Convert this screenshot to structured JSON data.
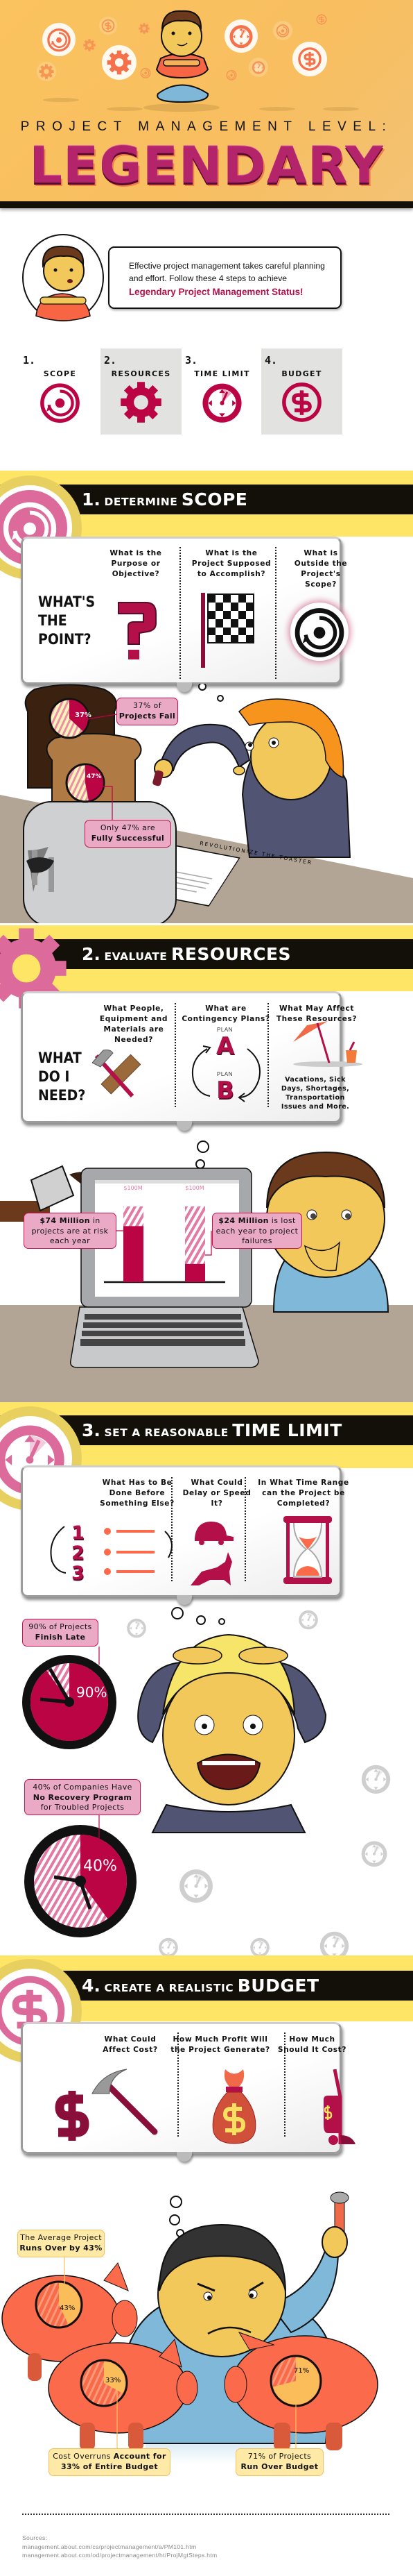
{
  "header": {
    "supertitle": "PROJECT MANAGEMENT LEVEL:",
    "title": "LEGENDARY"
  },
  "intro": {
    "text": "Effective project management takes careful planning and effort. Follow these 4 steps to achieve",
    "highlight": "Legendary Project Management Status!"
  },
  "steps": [
    {
      "number": "1.",
      "label": "SCOPE",
      "icon": "scope-target-icon"
    },
    {
      "number": "2.",
      "label": "RESOURCES",
      "icon": "gear-icon"
    },
    {
      "number": "3.",
      "label": "TIME LIMIT",
      "icon": "stopwatch-icon"
    },
    {
      "number": "4.",
      "label": "BUDGET",
      "icon": "dollar-coin-icon"
    }
  ],
  "sections": [
    {
      "number": "1.",
      "title_small": "DETERMINE",
      "title_big": "SCOPE",
      "prompt": "WHAT'S THE POINT?",
      "questions": [
        "What is the Purpose or Objective?",
        "What is the Project Supposed to Accomplish?",
        "What is Outside the Project's Scope?"
      ]
    },
    {
      "number": "2.",
      "title_small": "EVALUATE",
      "title_big": "RESOURCES",
      "prompt": "WHAT DO I NEED?",
      "questions": [
        "What People, Equipment and Materials are Needed?",
        "What are Contingency Plans?",
        "What May Affect These Resources?"
      ],
      "plans": [
        {
          "label": "PLAN",
          "letter": "A"
        },
        {
          "label": "PLAN",
          "letter": "B"
        }
      ],
      "affect_caption": "Vacations, Sick Days, Shortages, Transportation Issues and More."
    },
    {
      "number": "3.",
      "title_small": "SET A REASONABLE",
      "title_big": "TIME LIMIT",
      "questions": [
        "What Has to Be Done Before Something Else?",
        "What Could Delay or Speed It?",
        "In What Time Range can the Project be Completed?"
      ],
      "sequence": [
        "1",
        "2",
        "3"
      ]
    },
    {
      "number": "4.",
      "title_small": "CREATE A REALISTIC",
      "title_big": "BUDGET",
      "questions": [
        "What Could Affect Cost?",
        "How Much Profit Will the Project Generate?",
        "How Much Should It Cost?"
      ]
    }
  ],
  "scope_stats": {
    "paper_text": "REVOLUTIONIZE THE TOASTER",
    "failed": {
      "percent": 37,
      "pie_label": "37%",
      "line1": "37% of",
      "line2": "Projects Fail"
    },
    "successful": {
      "percent": 47,
      "pie_label": "47%",
      "line1": "Only 47% are",
      "line2": "Fully Successful"
    }
  },
  "resource_stats": {
    "bar_max_label": "$100M",
    "bar_max": 100,
    "at_risk": {
      "value": 74,
      "bold": "$74 Million",
      "rest": " in projects are at risk each year"
    },
    "lost": {
      "value": 24,
      "bold": "$24 Million",
      "rest": " is lost each year to project failures"
    }
  },
  "time_stats": {
    "late": {
      "percent": 90,
      "dial_label": "90%",
      "line1": "90% of Projects",
      "line2": "Finish Late"
    },
    "no_recovery": {
      "percent": 40,
      "dial_label": "40%",
      "line1": "40% of Companies Have",
      "line2": "No Recovery Program",
      "line3": "for Troubled Projects"
    }
  },
  "budget_stats": {
    "overrun": {
      "percent": 43,
      "pie_label": "43%",
      "line1": "The Average Project",
      "line2": "Runs Over by 43%"
    },
    "share": {
      "percent": 33,
      "pie_label": "33%",
      "plain": "Cost Overruns ",
      "bold1": "Account for",
      "bold2": "33% of Entire Budget"
    },
    "over_budget": {
      "percent": 71,
      "pie_label": "71%",
      "line1": "71% of Projects",
      "line2": "Run Over Budget"
    }
  },
  "sources": {
    "label": "Sources:",
    "links": [
      "management.about.com/cs/projectmanagement/a/PM101.htm",
      "management.about.com/od/projectmanagement/ht/ProjMgtSteps.htm"
    ]
  },
  "colors": {
    "accent": "#b3104a",
    "pink": "#dc6a9a",
    "header_orange": "#fbc35f",
    "band_yellow": "#fee565",
    "callout_pink": "#eaaac6",
    "callout_yellow": "#feeaa6",
    "piggy": "#fb6a4a"
  }
}
